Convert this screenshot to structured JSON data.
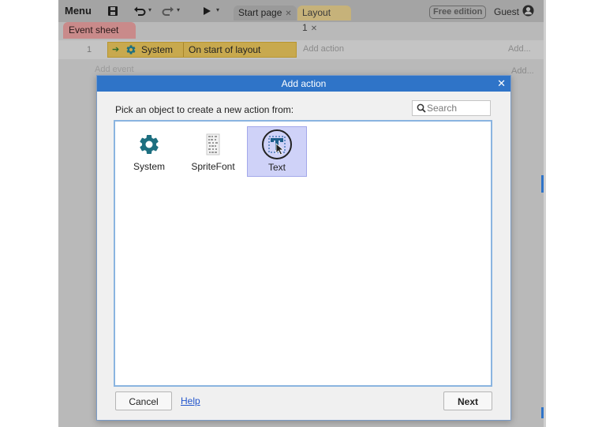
{
  "toolbar": {
    "menu_label": "Menu",
    "tabs": [
      {
        "label": "Start page"
      },
      {
        "label": "Layout 1"
      }
    ],
    "edition_badge": "Free edition",
    "user_label": "Guest"
  },
  "event_sheet": {
    "tab_label": "Event sheet 1",
    "row_number": "1",
    "condition_object": "System",
    "condition_text": "On start of layout",
    "add_action_label": "Add action",
    "add_label": "Add...",
    "add_event_label": "Add event"
  },
  "dialog": {
    "title": "Add action",
    "prompt": "Pick an object to create a new action from:",
    "search_placeholder": "Search",
    "objects": [
      {
        "label": "System",
        "icon": "gear-icon"
      },
      {
        "label": "SpriteFont",
        "icon": "spritefont-icon"
      },
      {
        "label": "Text",
        "icon": "text-object-icon",
        "selected": true
      }
    ],
    "cancel_label": "Cancel",
    "help_label": "Help",
    "next_label": "Next"
  },
  "colors": {
    "dialog_title_bar": "#2f74c8",
    "gear_icon": "#1d6f80",
    "selection": "#cfd2f8",
    "condition_block": "#c8a94e",
    "event_sheet_tab": "#c98a8a"
  }
}
